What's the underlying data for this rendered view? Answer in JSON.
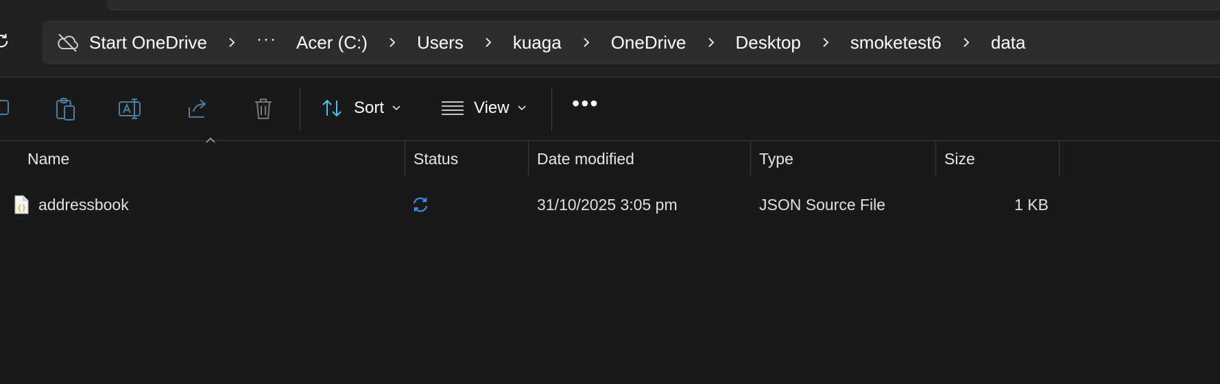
{
  "breadcrumb": {
    "onedrive_label": "Start OneDrive",
    "overflow_label": "···",
    "items": [
      "Acer (C:)",
      "Users",
      "kuaga",
      "OneDrive",
      "Desktop",
      "smoketest6",
      "data"
    ]
  },
  "toolbar": {
    "sort_label": "Sort",
    "view_label": "View",
    "more_label": "•••",
    "icons": [
      "new-icon",
      "paste-icon",
      "rename-icon",
      "share-icon",
      "delete-icon"
    ]
  },
  "columns": {
    "name": "Name",
    "status": "Status",
    "date": "Date modified",
    "type": "Type",
    "size": "Size"
  },
  "files": [
    {
      "name": "addressbook",
      "status_icon": "sync-pending-icon",
      "date": "31/10/2025 3:05 pm",
      "type": "JSON Source File",
      "size": "1 KB"
    }
  ],
  "colors": {
    "background": "#191919",
    "chrome": "#202020",
    "address_bar": "#2d2d2d",
    "accent_blue": "#4cc2ff",
    "sync_blue": "#3a8ee6"
  }
}
